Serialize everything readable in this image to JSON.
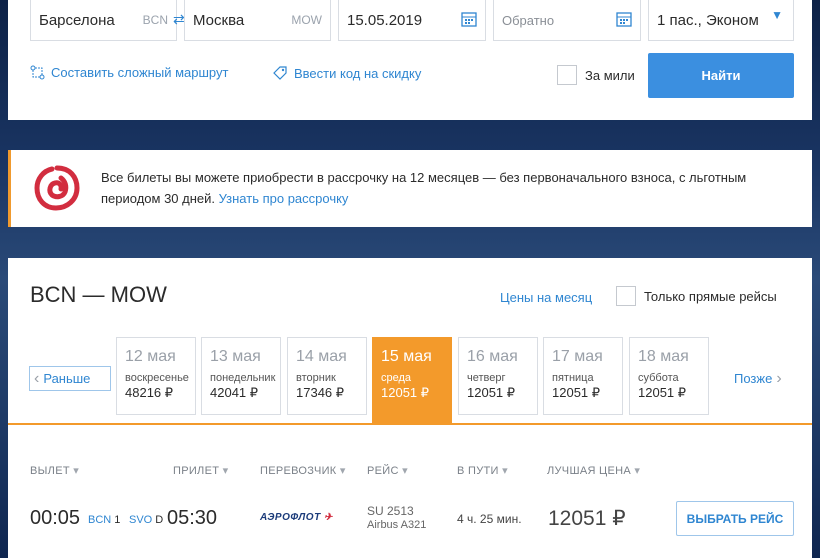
{
  "search": {
    "from_city": "Барселона",
    "from_code": "BCN",
    "to_city": "Москва",
    "to_code": "MOW",
    "date": "15.05.2019",
    "return_placeholder": "Обратно",
    "passengers": "1 пас., Эконом",
    "complex_route": "Составить сложный маршрут",
    "discount_code": "Ввести код на скидку",
    "miles_label": "За мили",
    "find_label": "Найти"
  },
  "promo": {
    "text": "Все билеты вы можете приобрести в рассрочку на 12 месяцев — без первоначального взноса, с льготным периодом 30 дней. ",
    "link": "Узнать про рассрочку"
  },
  "results": {
    "route": "BCN — MOW",
    "month_prices": "Цены на месяц",
    "direct_only": "Только прямые рейсы",
    "prev_label": "Раньше",
    "next_label": "Позже",
    "days": [
      {
        "date": "12 мая",
        "weekday": "воскресенье",
        "price": "48216 ₽"
      },
      {
        "date": "13 мая",
        "weekday": "понедельник",
        "price": "42041 ₽"
      },
      {
        "date": "14 мая",
        "weekday": "вторник",
        "price": "17346 ₽"
      },
      {
        "date": "15 мая",
        "weekday": "среда",
        "price": "12051 ₽"
      },
      {
        "date": "16 мая",
        "weekday": "четверг",
        "price": "12051 ₽"
      },
      {
        "date": "17 мая",
        "weekday": "пятница",
        "price": "12051 ₽"
      },
      {
        "date": "18 мая",
        "weekday": "суббота",
        "price": "12051 ₽"
      }
    ],
    "columns": [
      "ВЫЛЕТ",
      "ПРИЛЕТ",
      "ПЕРЕВОЗЧИК",
      "РЕЙС",
      "В ПУТИ",
      "ЛУЧШАЯ ЦЕНА"
    ],
    "flight": {
      "dep_time": "00:05",
      "dep_airport": "BCN",
      "dep_terminal": "1",
      "arr_airport": "SVO",
      "arr_terminal": "D",
      "arr_time": "05:30",
      "airline": "АЭРОФЛОТ",
      "flight_no": "SU 2513",
      "aircraft": "Airbus A321",
      "duration": "4 ч. 25 мин.",
      "price": "12051 ₽",
      "select_label": "ВЫБРАТЬ РЕЙС"
    }
  },
  "colors": {
    "accent": "#3b8fe0",
    "link": "#2f86d1",
    "active_day": "#f39a2b"
  }
}
